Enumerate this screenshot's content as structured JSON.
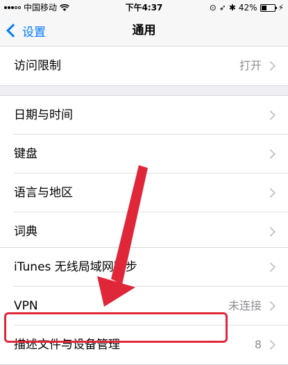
{
  "status_bar": {
    "carrier": "中国移动",
    "time": "下午4:37",
    "battery": "42%",
    "battery_level": 0.42
  },
  "nav": {
    "back_label": "设置",
    "title": "通用"
  },
  "groups": [
    {
      "rows": [
        {
          "label": "访问限制",
          "detail": "打开"
        }
      ]
    },
    {
      "rows": [
        {
          "label": "日期与时间",
          "detail": ""
        },
        {
          "label": "键盘",
          "detail": ""
        },
        {
          "label": "语言与地区",
          "detail": ""
        },
        {
          "label": "词典",
          "detail": ""
        }
      ]
    },
    {
      "rows": [
        {
          "label": "iTunes 无线局域网同步",
          "detail": ""
        },
        {
          "label": "VPN",
          "detail": "未连接"
        },
        {
          "label": "描述文件与设备管理",
          "detail": "8"
        }
      ]
    }
  ],
  "annotation_color": "#e0273a"
}
